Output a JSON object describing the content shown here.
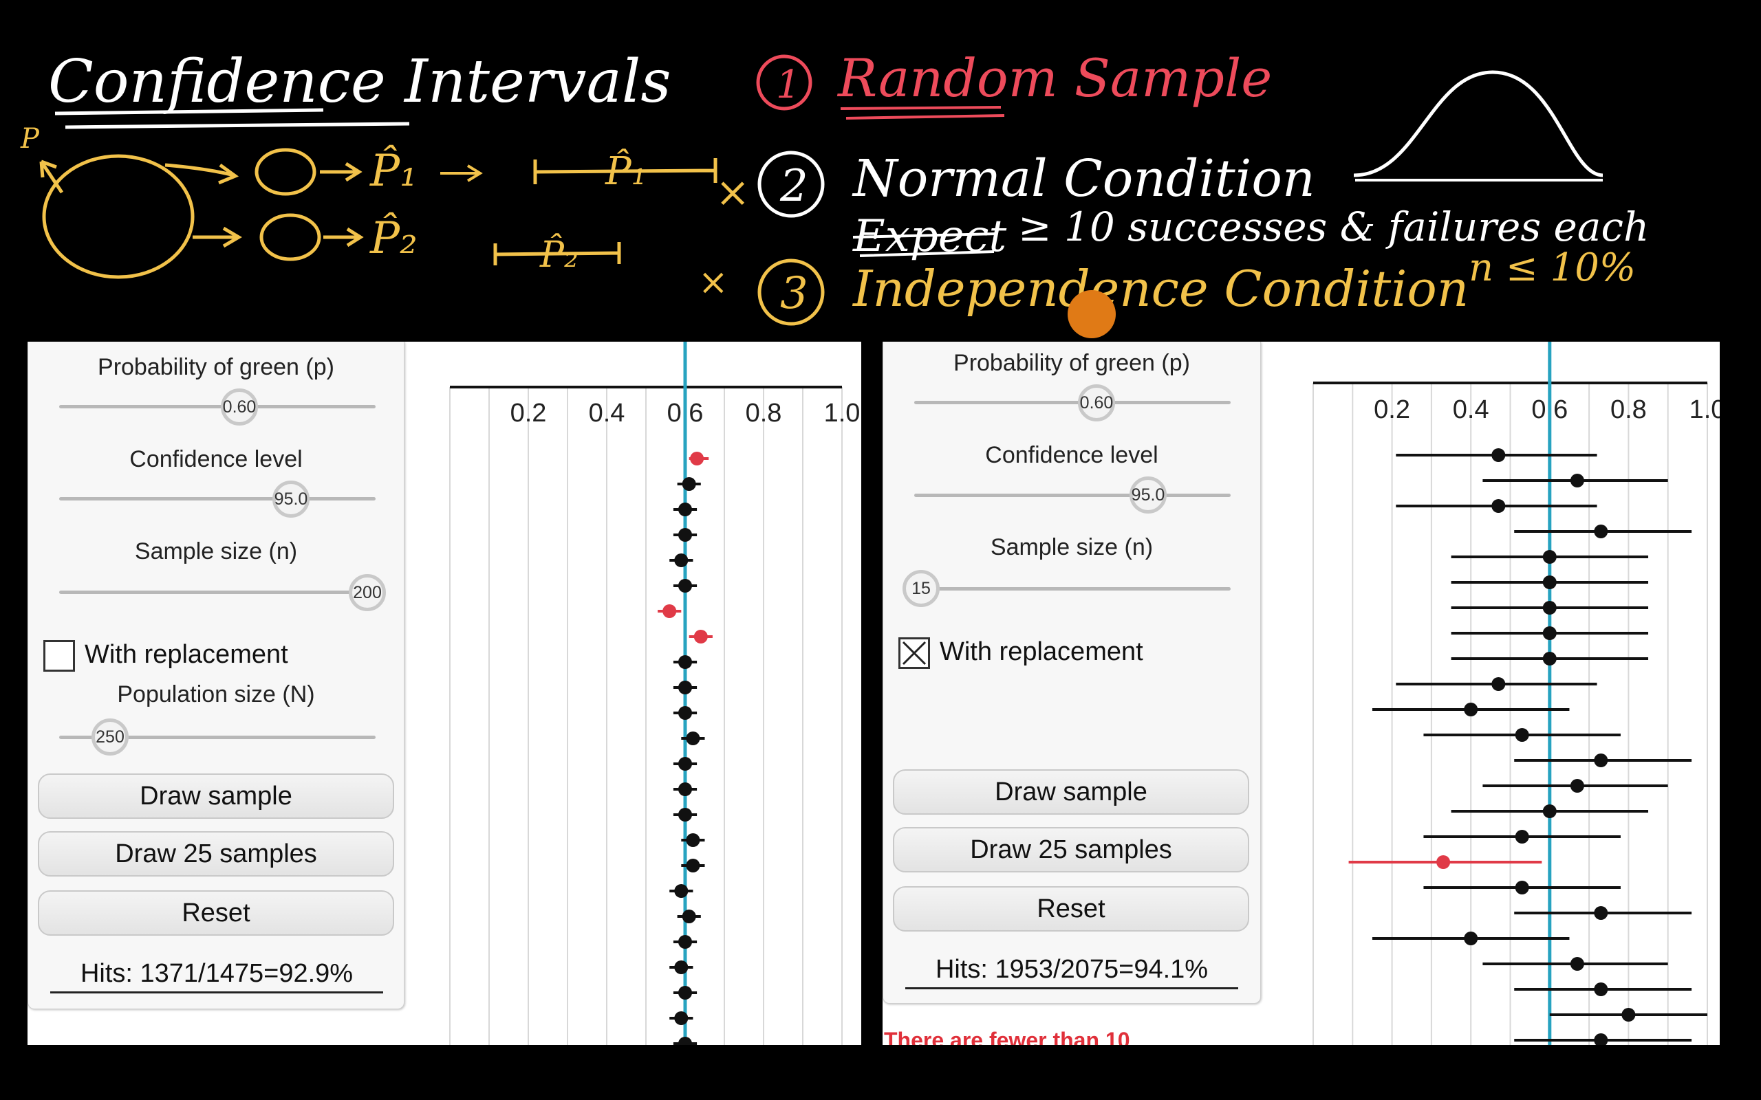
{
  "notes": {
    "title": "Confidence Intervals",
    "cond1": "Random Sample",
    "cond2": "Normal Condition",
    "cond2_detail_strike": "Expect",
    "cond2_detail": "≥ 10 successes & failures each",
    "cond3": "Independence Condition",
    "cond3_detail": "n ≤ 10%",
    "p_label": "P",
    "phat1": "P̂₁",
    "phat2": "P̂₂",
    "num1": "1",
    "num2": "2",
    "num3": "3",
    "x_mark": "×"
  },
  "colors": {
    "yellow": "#f2c24a",
    "red": "#ee4b5b",
    "white": "#ffffff",
    "cyan": "#27a3c0",
    "black_point": "#111111",
    "red_point": "#e03a47"
  },
  "left": {
    "prob_label": "Probability of green (p)",
    "prob_value": "0.60",
    "conf_label": "Confidence level",
    "conf_value": "95.0",
    "size_label": "Sample size (n)",
    "size_value": "200",
    "replacement_label": "With replacement",
    "replacement_checked": false,
    "pop_label": "Population size (N)",
    "pop_value": "250",
    "btn_draw": "Draw sample",
    "btn_draw25": "Draw 25 samples",
    "btn_reset": "Reset",
    "hits": "Hits: 1371/1475=92.9%"
  },
  "right": {
    "prob_label": "Probability of green (p)",
    "prob_value": "0.60",
    "conf_label": "Confidence level",
    "conf_value": "95.0",
    "size_label": "Sample size (n)",
    "size_value": "15",
    "replacement_label": "With replacement",
    "replacement_checked": true,
    "btn_draw": "Draw sample",
    "btn_draw25": "Draw 25 samples",
    "btn_reset": "Reset",
    "hits": "Hits: 1953/2075=94.1%",
    "warning": "There are fewer than 10"
  },
  "chart_data": [
    {
      "type": "scatter",
      "name": "left-intervals",
      "x_ticks": [
        "0.2",
        "0.4",
        "0.6",
        "0.8",
        "1.0"
      ],
      "xlim": [
        0.0,
        1.0
      ],
      "true_p": 0.6,
      "intervals": [
        {
          "center": 0.63,
          "lo": 0.61,
          "hi": 0.66,
          "hit": false
        },
        {
          "center": 0.61,
          "lo": 0.58,
          "hi": 0.64,
          "hit": true
        },
        {
          "center": 0.6,
          "lo": 0.57,
          "hi": 0.63,
          "hit": true
        },
        {
          "center": 0.6,
          "lo": 0.57,
          "hi": 0.63,
          "hit": true
        },
        {
          "center": 0.59,
          "lo": 0.56,
          "hi": 0.62,
          "hit": true
        },
        {
          "center": 0.6,
          "lo": 0.57,
          "hi": 0.63,
          "hit": true
        },
        {
          "center": 0.56,
          "lo": 0.53,
          "hi": 0.59,
          "hit": false
        },
        {
          "center": 0.64,
          "lo": 0.61,
          "hi": 0.67,
          "hit": false
        },
        {
          "center": 0.6,
          "lo": 0.57,
          "hi": 0.63,
          "hit": true
        },
        {
          "center": 0.6,
          "lo": 0.57,
          "hi": 0.63,
          "hit": true
        },
        {
          "center": 0.6,
          "lo": 0.57,
          "hi": 0.63,
          "hit": true
        },
        {
          "center": 0.62,
          "lo": 0.59,
          "hi": 0.65,
          "hit": true
        },
        {
          "center": 0.6,
          "lo": 0.57,
          "hi": 0.63,
          "hit": true
        },
        {
          "center": 0.6,
          "lo": 0.57,
          "hi": 0.63,
          "hit": true
        },
        {
          "center": 0.6,
          "lo": 0.57,
          "hi": 0.63,
          "hit": true
        },
        {
          "center": 0.62,
          "lo": 0.59,
          "hi": 0.65,
          "hit": true
        },
        {
          "center": 0.62,
          "lo": 0.59,
          "hi": 0.65,
          "hit": true
        },
        {
          "center": 0.59,
          "lo": 0.56,
          "hi": 0.62,
          "hit": true
        },
        {
          "center": 0.61,
          "lo": 0.58,
          "hi": 0.64,
          "hit": true
        },
        {
          "center": 0.6,
          "lo": 0.57,
          "hi": 0.63,
          "hit": true
        },
        {
          "center": 0.59,
          "lo": 0.56,
          "hi": 0.62,
          "hit": true
        },
        {
          "center": 0.6,
          "lo": 0.57,
          "hi": 0.63,
          "hit": true
        },
        {
          "center": 0.59,
          "lo": 0.56,
          "hi": 0.62,
          "hit": true
        },
        {
          "center": 0.6,
          "lo": 0.57,
          "hi": 0.63,
          "hit": true
        }
      ]
    },
    {
      "type": "scatter",
      "name": "right-intervals",
      "x_ticks": [
        "0.2",
        "0.4",
        "0.6",
        "0.8",
        "1.0"
      ],
      "xlim": [
        0.0,
        1.0
      ],
      "true_p": 0.6,
      "intervals": [
        {
          "center": 0.47,
          "lo": 0.21,
          "hi": 0.72,
          "hit": true
        },
        {
          "center": 0.67,
          "lo": 0.43,
          "hi": 0.9,
          "hit": true
        },
        {
          "center": 0.47,
          "lo": 0.21,
          "hi": 0.72,
          "hit": true
        },
        {
          "center": 0.73,
          "lo": 0.51,
          "hi": 0.96,
          "hit": true
        },
        {
          "center": 0.6,
          "lo": 0.35,
          "hi": 0.85,
          "hit": true
        },
        {
          "center": 0.6,
          "lo": 0.35,
          "hi": 0.85,
          "hit": true
        },
        {
          "center": 0.6,
          "lo": 0.35,
          "hi": 0.85,
          "hit": true
        },
        {
          "center": 0.6,
          "lo": 0.35,
          "hi": 0.85,
          "hit": true
        },
        {
          "center": 0.6,
          "lo": 0.35,
          "hi": 0.85,
          "hit": true
        },
        {
          "center": 0.47,
          "lo": 0.21,
          "hi": 0.72,
          "hit": true
        },
        {
          "center": 0.4,
          "lo": 0.15,
          "hi": 0.65,
          "hit": true
        },
        {
          "center": 0.53,
          "lo": 0.28,
          "hi": 0.78,
          "hit": true
        },
        {
          "center": 0.73,
          "lo": 0.51,
          "hi": 0.96,
          "hit": true
        },
        {
          "center": 0.67,
          "lo": 0.43,
          "hi": 0.9,
          "hit": true
        },
        {
          "center": 0.6,
          "lo": 0.35,
          "hi": 0.85,
          "hit": true
        },
        {
          "center": 0.53,
          "lo": 0.28,
          "hi": 0.78,
          "hit": true
        },
        {
          "center": 0.33,
          "lo": 0.09,
          "hi": 0.58,
          "hit": false
        },
        {
          "center": 0.53,
          "lo": 0.28,
          "hi": 0.78,
          "hit": true
        },
        {
          "center": 0.73,
          "lo": 0.51,
          "hi": 0.96,
          "hit": true
        },
        {
          "center": 0.4,
          "lo": 0.15,
          "hi": 0.65,
          "hit": true
        },
        {
          "center": 0.67,
          "lo": 0.43,
          "hi": 0.9,
          "hit": true
        },
        {
          "center": 0.73,
          "lo": 0.51,
          "hi": 0.96,
          "hit": true
        },
        {
          "center": 0.8,
          "lo": 0.6,
          "hi": 1.0,
          "hit": true
        },
        {
          "center": 0.73,
          "lo": 0.51,
          "hi": 0.96,
          "hit": true
        }
      ]
    }
  ]
}
